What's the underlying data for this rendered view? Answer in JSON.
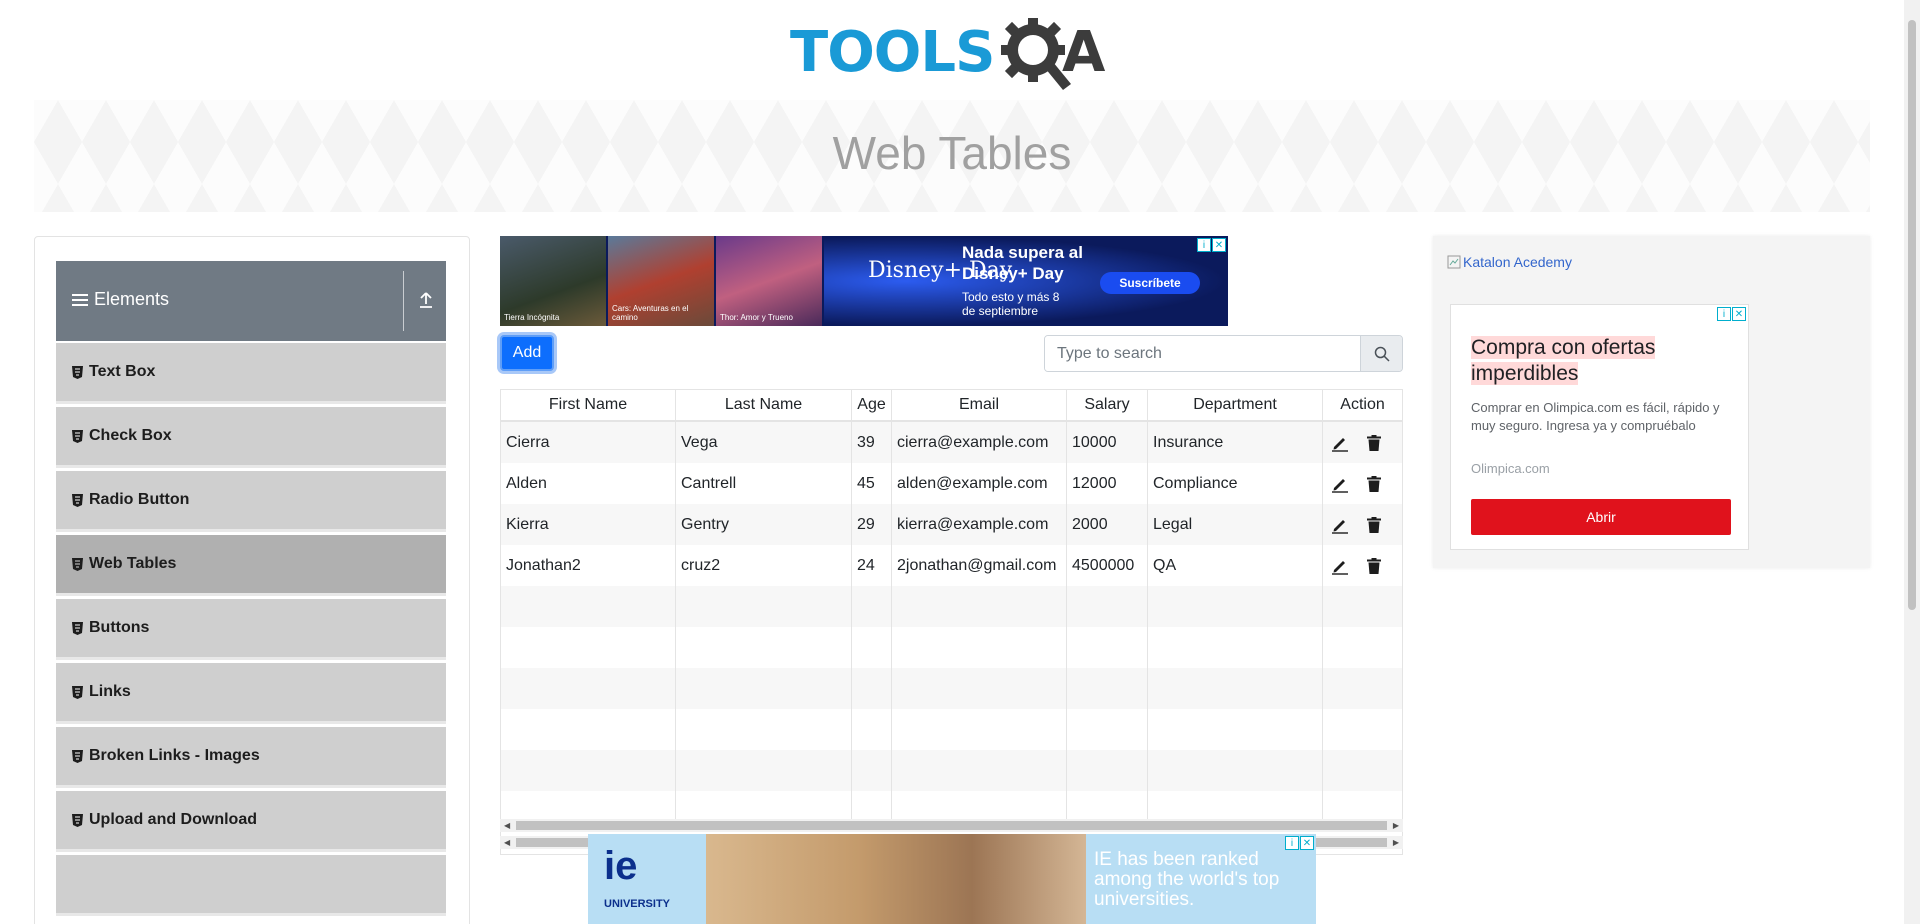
{
  "logo": {
    "text_main": "TOOLS",
    "text_q": "Q",
    "text_a": "A"
  },
  "banner": {
    "title": "Web Tables"
  },
  "sidebar": {
    "group_title": "Elements",
    "items": [
      {
        "label": "Text Box"
      },
      {
        "label": "Check Box"
      },
      {
        "label": "Radio Button"
      },
      {
        "label": "Web Tables",
        "active": true
      },
      {
        "label": "Buttons"
      },
      {
        "label": "Links"
      },
      {
        "label": "Broken Links - Images"
      },
      {
        "label": "Upload and Download"
      }
    ]
  },
  "ad_top": {
    "posters": [
      "Tierra Incógnita",
      "Cars: Aventuras en el camino",
      "Thor: Amor y Trueno"
    ],
    "logo": "Disney+ Day",
    "headline": "Nada supera al Disney+ Day",
    "subline": "Todo esto y más 8 de septiembre",
    "cta": "Suscríbete"
  },
  "toolbar": {
    "add_label": "Add",
    "search_placeholder": "Type to search"
  },
  "table": {
    "headers": [
      "First Name",
      "Last Name",
      "Age",
      "Email",
      "Salary",
      "Department",
      "Action"
    ],
    "rows": [
      [
        "Cierra",
        "Vega",
        "39",
        "cierra@example.com",
        "10000",
        "Insurance"
      ],
      [
        "Alden",
        "Cantrell",
        "45",
        "alden@example.com",
        "12000",
        "Compliance"
      ],
      [
        "Kierra",
        "Gentry",
        "29",
        "kierra@example.com",
        "2000",
        "Legal"
      ],
      [
        "Jonathan2",
        "cruz2",
        "24",
        "2jonathan@gmail.com",
        "4500000",
        "QA"
      ]
    ],
    "empty_rows": 6
  },
  "ad_right": {
    "link_text": "Katalon Acedemy",
    "title": "Compra con ofertas imperdibles",
    "body": "Comprar en Olimpica.com es fácil, rápido y muy seguro. Ingresa ya y compruébalo",
    "url": "Olimpica.com",
    "cta": "Abrir"
  },
  "ad_bottom": {
    "logo": "ie",
    "logo_sub": "UNIVERSITY",
    "text": "IE has been ranked among the world's top universities."
  },
  "colors": {
    "accent": "#0d6efd",
    "sidebar_header": "#707a84",
    "sidebar_item": "#cfcfcf",
    "sidebar_active": "#b0b0b0",
    "logo_blue": "#1a9ad6",
    "cta_red": "#e0121c"
  },
  "icons": {
    "menu": "hamburger-icon",
    "collapse": "collapse-up-icon",
    "item": "html5-badge-icon",
    "search": "search-icon",
    "edit": "pencil-icon",
    "delete": "trash-icon"
  }
}
